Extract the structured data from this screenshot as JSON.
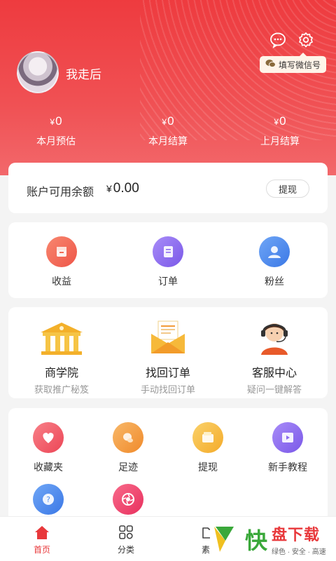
{
  "header": {
    "username": "我走后",
    "wechat_tip": "填写微信号",
    "icons": [
      "message-icon",
      "settings-icon"
    ]
  },
  "stats": [
    {
      "currency": "¥",
      "value": "0",
      "label": "本月预估"
    },
    {
      "currency": "¥",
      "value": "0",
      "label": "本月结算"
    },
    {
      "currency": "¥",
      "value": "0",
      "label": "上月结算"
    }
  ],
  "balance": {
    "label": "账户可用余额",
    "currency": "¥",
    "amount": "0.00",
    "withdraw_label": "提现"
  },
  "quick": [
    {
      "label": "收益",
      "icon": "income-icon",
      "color": "#f26a55"
    },
    {
      "label": "订单",
      "icon": "order-icon",
      "color": "#8c6cf0"
    },
    {
      "label": "粉丝",
      "icon": "fans-icon",
      "color": "#4f8ef0"
    }
  ],
  "features": [
    {
      "title": "商学院",
      "subtitle": "获取推广秘笈",
      "icon": "academy-icon"
    },
    {
      "title": "找回订单",
      "subtitle": "手动找回订单",
      "icon": "envelope-icon"
    },
    {
      "title": "客服中心",
      "subtitle": "疑问一键解答",
      "icon": "customer-service-icon"
    }
  ],
  "tools": [
    {
      "label": "收藏夹",
      "icon": "favorites-icon",
      "color": "#f0525e"
    },
    {
      "label": "足迹",
      "icon": "footprint-icon",
      "color": "#f49a3c"
    },
    {
      "label": "提现",
      "icon": "withdraw-icon",
      "color": "#f5b93a"
    },
    {
      "label": "新手教程",
      "icon": "tutorial-icon",
      "color": "#8c6cf0"
    },
    {
      "label": "",
      "icon": "help-icon",
      "color": "#4f8ef0"
    },
    {
      "label": "",
      "icon": "aperture-icon",
      "color": "#f0406e"
    }
  ],
  "tabbar": [
    {
      "label": "首页",
      "icon": "home-icon",
      "active": true
    },
    {
      "label": "分类",
      "icon": "category-icon",
      "active": false
    },
    {
      "label": "素材",
      "icon": "folder-icon",
      "active": false
    }
  ],
  "watermark": {
    "brand": "快",
    "name": "盘下载",
    "tagline": "绿色 · 安全 · 高速"
  }
}
